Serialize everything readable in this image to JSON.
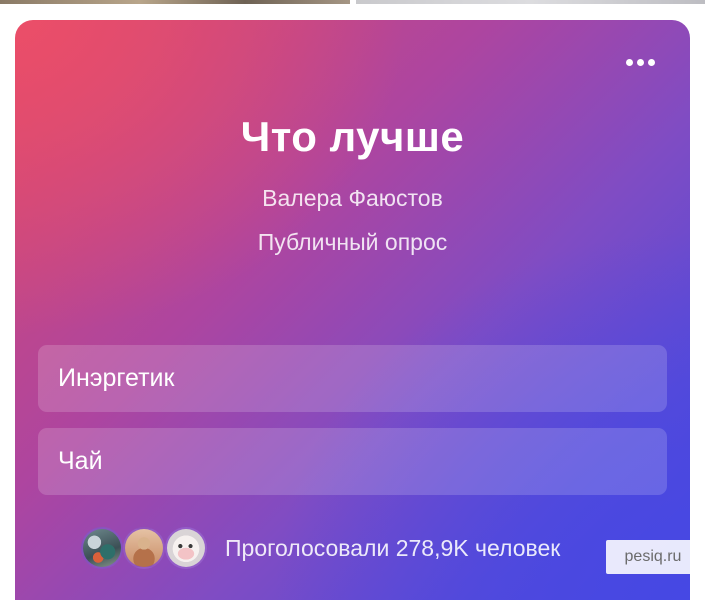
{
  "poll": {
    "title": "Что лучше",
    "author": "Валера Фаюстов",
    "type": "Публичный опрос",
    "options": [
      {
        "label": "Инэргетик"
      },
      {
        "label": "Чай"
      }
    ],
    "votes_text": "Проголосовали 278,9K человек",
    "more_icon": "more-horizontal-icon",
    "gradient_colors": [
      "#e94e6a",
      "#ad45a0",
      "#7f4cc4",
      "#4748de"
    ]
  },
  "watermark": {
    "text": "pesiq.ru"
  }
}
